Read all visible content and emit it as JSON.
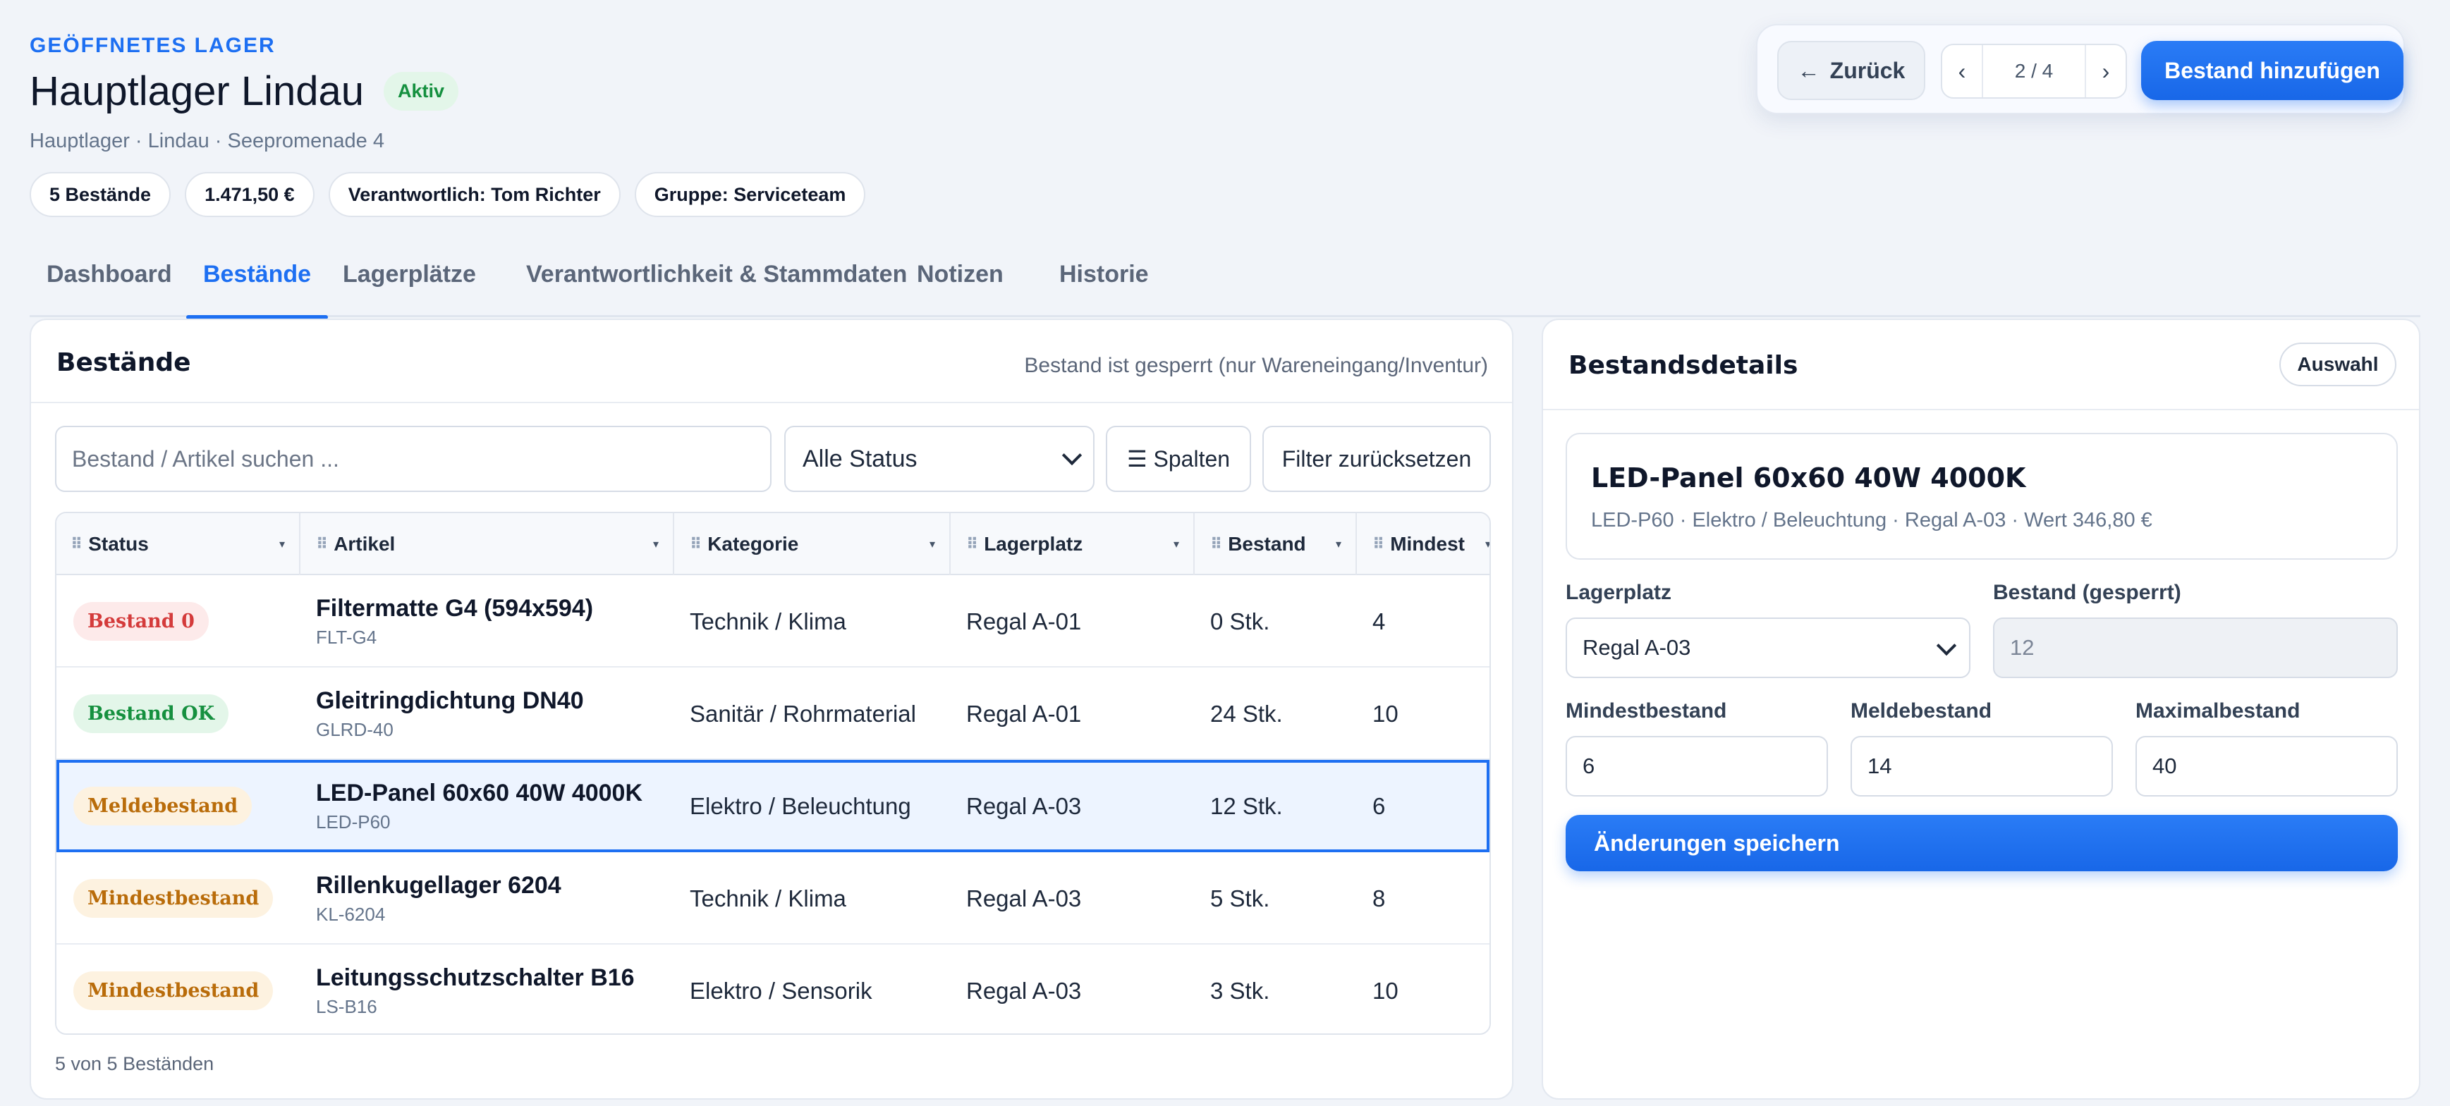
{
  "header": {
    "eyebrow": "GEÖFFNETES LAGER",
    "title": "Hauptlager Lindau",
    "status_badge": "Aktiv",
    "subtitle": "Hauptlager · Lindau · Seepromenade 4",
    "chips": [
      "5 Bestände",
      "1.471,50 €",
      "Verantwortlich: Tom Richter",
      "Gruppe: Serviceteam"
    ]
  },
  "actions": {
    "back_label": "Zurück",
    "back_arrow": "←",
    "pager": {
      "prev": "‹",
      "label": "2 / 4",
      "next": "›"
    },
    "add_label": "Bestand hinzufügen"
  },
  "tabs": [
    "Dashboard",
    "Bestände",
    "Lagerplätze",
    "Verantwortlichkeit & Stammdaten",
    "Notizen",
    "Historie"
  ],
  "active_tab": "Bestände",
  "inventory": {
    "title": "Bestände",
    "note": "Bestand ist gesperrt (nur Wareneingang/Inventur)",
    "search_placeholder": "Bestand / Artikel suchen ...",
    "status_filter": "Alle Status",
    "columns_button": "☰ Spalten",
    "reset_button": "Filter zurücksetzen",
    "columns": [
      "Status",
      "Artikel",
      "Kategorie",
      "Lagerplatz",
      "Bestand",
      "Mindest"
    ],
    "rows": [
      {
        "status": "Bestand 0",
        "status_color": "red",
        "article": "Filtermatte G4 (594x594)",
        "code": "FLT-G4",
        "category": "Technik / Klima",
        "location": "Regal A-01",
        "stock": "0 Stk.",
        "min": "4"
      },
      {
        "status": "Bestand OK",
        "status_color": "green",
        "article": "Gleitringdichtung DN40",
        "code": "GLRD-40",
        "category": "Sanitär / Rohrmaterial",
        "location": "Regal A-01",
        "stock": "24 Stk.",
        "min": "10"
      },
      {
        "status": "Meldebestand",
        "status_color": "amber",
        "article": "LED-Panel 60x60 40W 4000K",
        "code": "LED-P60",
        "category": "Elektro / Beleuchtung",
        "location": "Regal A-03",
        "stock": "12 Stk.",
        "min": "6",
        "selected": true
      },
      {
        "status": "Mindestbestand",
        "status_color": "amber",
        "article": "Rillenkugellager 6204",
        "code": "KL-6204",
        "category": "Technik / Klima",
        "location": "Regal A-03",
        "stock": "5 Stk.",
        "min": "8"
      },
      {
        "status": "Mindestbestand",
        "status_color": "amber",
        "article": "Leitungsschutzschalter B16",
        "code": "LS-B16",
        "category": "Elektro / Sensorik",
        "location": "Regal A-03",
        "stock": "3 Stk.",
        "min": "10"
      }
    ],
    "footer": "5 von 5 Beständen"
  },
  "details": {
    "title": "Bestandsdetails",
    "select_button": "Auswahl",
    "item_title": "LED-Panel 60x60 40W 4000K",
    "item_sub": "LED-P60 · Elektro / Beleuchtung · Regal A-03 · Wert 346,80 €",
    "location_label": "Lagerplatz",
    "location_value": "Regal A-03",
    "stock_label": "Bestand (gesperrt)",
    "stock_value": "12",
    "min_label": "Mindestbestand",
    "min_value": "6",
    "report_label": "Meldebestand",
    "report_value": "14",
    "max_label": "Maximalbestand",
    "max_value": "40",
    "save_label": "Änderungen speichern"
  },
  "colors": {
    "accent": "#1d6ff2",
    "success": "#15903f",
    "danger": "#d43b3b",
    "warning": "#b96c0a"
  }
}
